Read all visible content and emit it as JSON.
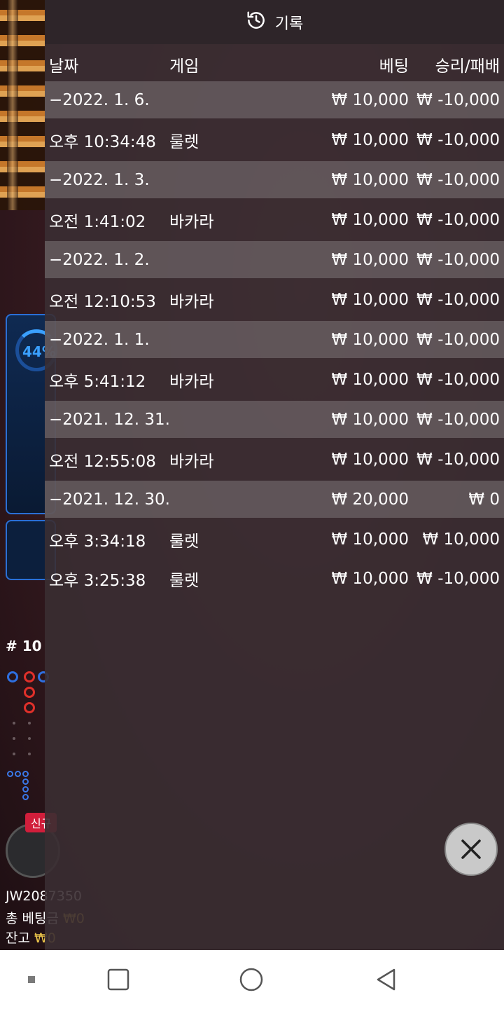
{
  "header": {
    "title": "기록"
  },
  "columns": {
    "date": "날짜",
    "game": "게임",
    "bet": "베팅",
    "result": "승리/패배"
  },
  "rows": [
    {
      "kind": "date",
      "date": "−2022. 1. 6.",
      "game": "",
      "bet": "₩ 10,000",
      "result": "₩ -10,000"
    },
    {
      "kind": "entry",
      "date": "오후 10:34:48",
      "game": "룰렛",
      "bet": "₩ 10,000",
      "result": "₩ -10,000"
    },
    {
      "kind": "date",
      "date": "−2022. 1. 3.",
      "game": "",
      "bet": "₩ 10,000",
      "result": "₩ -10,000"
    },
    {
      "kind": "entry",
      "date": "오전 1:41:02",
      "game": "바카라",
      "bet": "₩ 10,000",
      "result": "₩ -10,000"
    },
    {
      "kind": "date",
      "date": "−2022. 1. 2.",
      "game": "",
      "bet": "₩ 10,000",
      "result": "₩ -10,000"
    },
    {
      "kind": "entry",
      "date": "오전 12:10:53",
      "game": "바카라",
      "bet": "₩ 10,000",
      "result": "₩ -10,000"
    },
    {
      "kind": "date",
      "date": "−2022. 1. 1.",
      "game": "",
      "bet": "₩ 10,000",
      "result": "₩ -10,000"
    },
    {
      "kind": "entry",
      "date": "오후 5:41:12",
      "game": "바카라",
      "bet": "₩ 10,000",
      "result": "₩ -10,000"
    },
    {
      "kind": "date",
      "date": "−2021. 12. 31.",
      "game": "",
      "bet": "₩ 10,000",
      "result": "₩ -10,000"
    },
    {
      "kind": "entry",
      "date": "오전 12:55:08",
      "game": "바카라",
      "bet": "₩ 10,000",
      "result": "₩ -10,000"
    },
    {
      "kind": "date",
      "date": "−2021. 12. 30.",
      "game": "",
      "bet": "₩ 20,000",
      "result": "₩ 0"
    },
    {
      "kind": "entry",
      "date": "오후 3:34:18",
      "game": "룰렛",
      "bet": "₩ 10,000",
      "result": "₩ 10,000"
    },
    {
      "kind": "entry",
      "date": "오후 3:25:38",
      "game": "룰렛",
      "bet": "₩ 10,000",
      "result": "₩ -10,000"
    }
  ],
  "background": {
    "blue_panel_percent": "44",
    "round_label": "# 10",
    "new_badge": "신규",
    "player_id": "JW2087350",
    "total_bet_label": "총 베팅금",
    "total_bet_value": "₩0",
    "balance_label": "잔고",
    "balance_value": "₩0"
  },
  "icons": {
    "history": "history-icon",
    "close": "close-icon",
    "nav_recent": "square-icon",
    "nav_home": "circle-icon",
    "nav_back": "triangle-back-icon"
  },
  "colors": {
    "overlay_bg": "#3a2e32",
    "date_row_bg": "#7d7679",
    "text": "#ffffff",
    "accent_blue": "#2a6fd6",
    "badge_red": "#d11e3b"
  }
}
